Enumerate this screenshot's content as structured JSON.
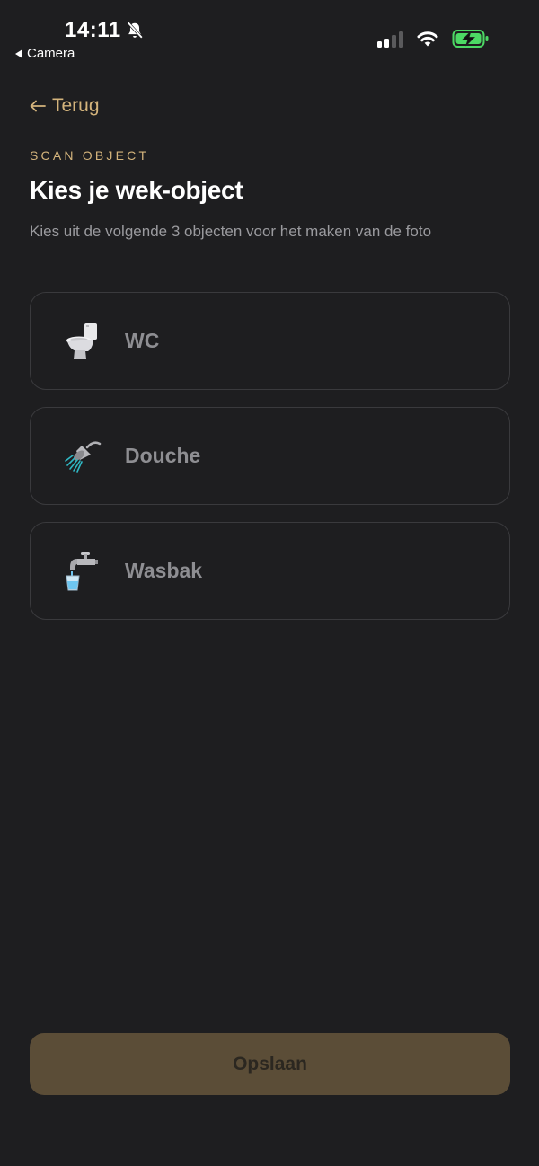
{
  "status_bar": {
    "time": "14:11",
    "back_app": "Camera"
  },
  "header": {
    "back_label": "Terug",
    "overline": "SCAN OBJECT",
    "title": "Kies je wek-object",
    "subtitle": "Kies uit de volgende 3 objecten voor het maken van de foto"
  },
  "options": [
    {
      "label": "WC",
      "icon": "toilet-icon"
    },
    {
      "label": "Douche",
      "icon": "shower-icon"
    },
    {
      "label": "Wasbak",
      "icon": "faucet-icon"
    }
  ],
  "footer": {
    "save_label": "Opslaan"
  },
  "colors": {
    "background": "#1e1e20",
    "accent": "#d4b47c",
    "save_button": "#5b4d37",
    "card_border": "#3a3a3d",
    "battery": "#4cd964"
  }
}
